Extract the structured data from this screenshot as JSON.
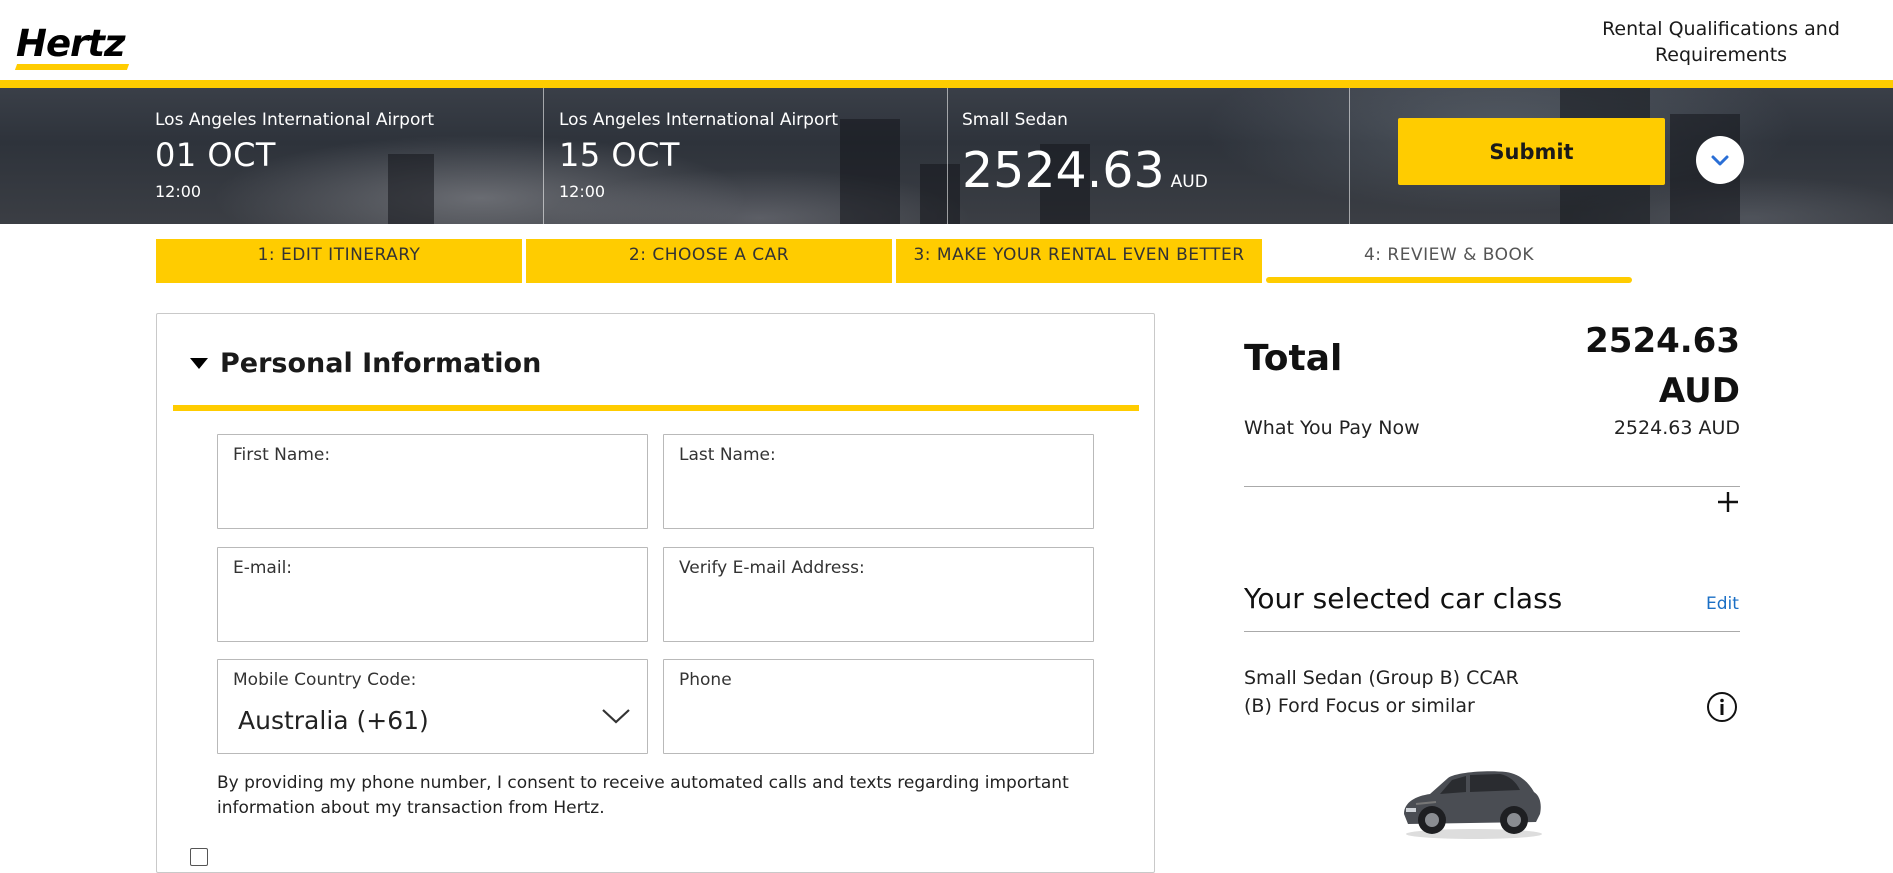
{
  "brand": {
    "logo_text": "Hertz"
  },
  "topnav": {
    "qualifications_link": "Rental Qualifications and Requirements"
  },
  "itinerary": {
    "pickup": {
      "location": "Los Angeles International Airport",
      "date": "01 OCT",
      "time": "12:00"
    },
    "dropoff": {
      "location": "Los Angeles International Airport",
      "date": "15 OCT",
      "time": "12:00"
    },
    "vehicle": {
      "class": "Small Sedan",
      "price": "2524.63",
      "currency": "AUD"
    },
    "submit_label": "Submit"
  },
  "steps": [
    {
      "label": "1:  EDIT ITINERARY",
      "state": "complete"
    },
    {
      "label": "2:  CHOOSE A CAR",
      "state": "complete"
    },
    {
      "label": "3:  MAKE YOUR RENTAL EVEN BETTER",
      "state": "complete"
    },
    {
      "label": "4:  REVIEW & BOOK",
      "state": "current"
    }
  ],
  "personal_info": {
    "title": "Personal Information",
    "fields": {
      "first_name": {
        "label": "First Name:",
        "value": ""
      },
      "last_name": {
        "label": "Last Name:",
        "value": ""
      },
      "email": {
        "label": "E-mail:",
        "value": ""
      },
      "verify_email": {
        "label": "Verify E-mail Address:",
        "value": ""
      },
      "country_code": {
        "label": "Mobile Country Code:",
        "value": "Australia (+61)"
      },
      "phone": {
        "label": "Phone",
        "value": ""
      }
    },
    "consent_text": "By providing my phone number, I consent to receive automated calls and texts regarding important information about my transaction from Hertz."
  },
  "summary": {
    "total_label": "Total",
    "total_value": "2524.63",
    "total_currency": "AUD",
    "pay_now_label": "What You Pay Now",
    "pay_now_value": "2524.63 AUD",
    "selected_title": "Your selected car class",
    "edit_label": "Edit",
    "car_line1": "Small Sedan (Group B) CCAR",
    "car_line2": "(B) Ford Focus or similar"
  },
  "colors": {
    "brand_yellow": "#ffcc00",
    "link_blue": "#1a6fc5",
    "hero_dark": "#2e333b"
  },
  "icons": [
    "chevron-down-icon",
    "plus-icon",
    "info-icon",
    "caret-down-icon"
  ]
}
